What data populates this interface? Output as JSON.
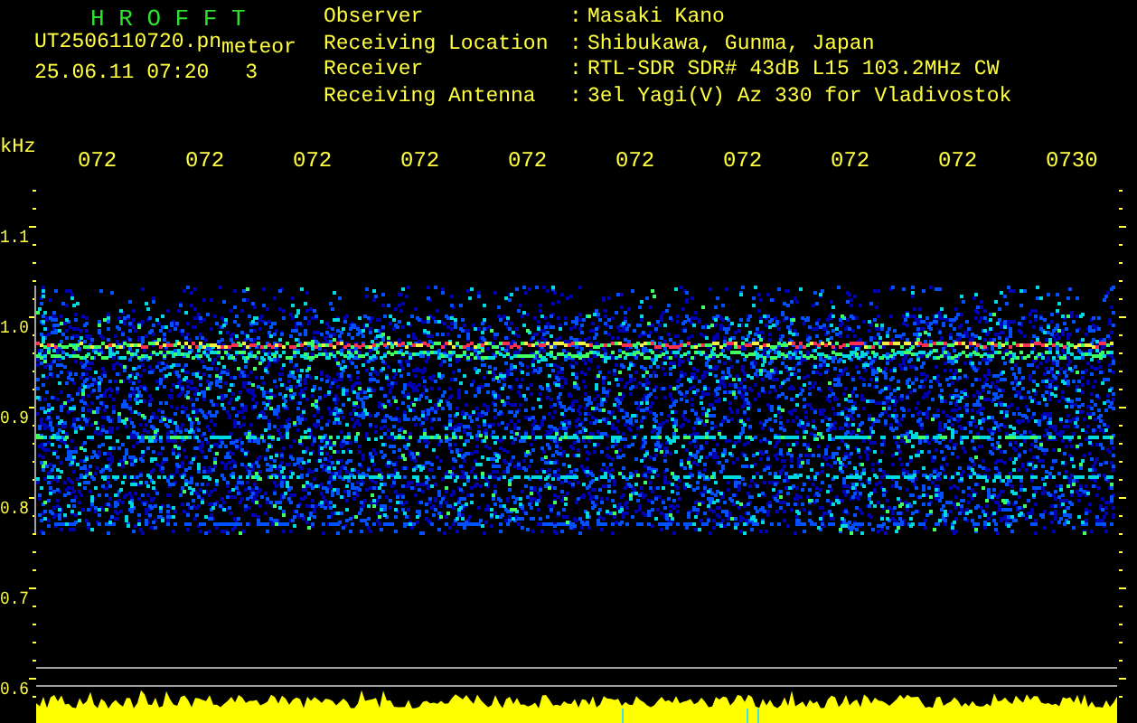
{
  "app_title": "H R O F F T",
  "file": {
    "name": "UT2506110720.pn",
    "tag": "meteor",
    "datetime": "25.06.11 07:20",
    "count": "3"
  },
  "info": [
    {
      "label": "Observer",
      "separator": ":",
      "value": "Masaki Kano"
    },
    {
      "label": "Receiving Location",
      "separator": ":",
      "value": "Shibukawa, Gunma, Japan"
    },
    {
      "label": "Receiver",
      "separator": ":",
      "value": "RTL-SDR SDR# 43dB L15 103.2MHz CW"
    },
    {
      "label": "Receiving Antenna",
      "separator": ":",
      "value": "3el Yagi(V) Az 330 for Vladivostok"
    }
  ],
  "y_unit": "kHz",
  "time_labels": [
    "072",
    "072",
    "072",
    "072",
    "072",
    "072",
    "072",
    "072",
    "072",
    "0730"
  ],
  "y_labels": [
    "1.1",
    "1.0",
    "0.9",
    "0.8",
    "0.7",
    "0.6"
  ]
}
